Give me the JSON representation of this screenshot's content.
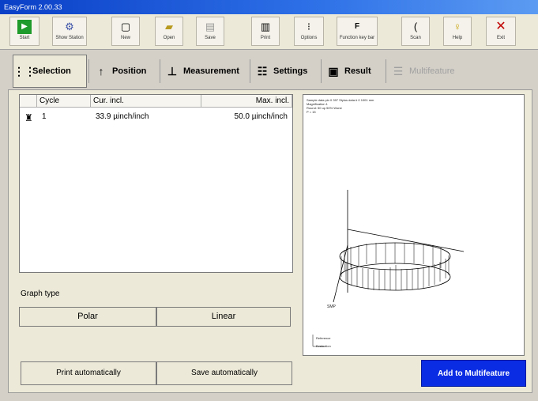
{
  "window": {
    "title": "EasyForm 2.00.33"
  },
  "toolbar": {
    "buttons": [
      {
        "label": "Start",
        "icon": "play-icon"
      },
      {
        "label": "Show Station",
        "icon": "station-icon"
      },
      {
        "label": "New",
        "icon": "new-file-icon"
      },
      {
        "label": "Open",
        "icon": "open-folder-icon"
      },
      {
        "label": "Save",
        "icon": "save-icon"
      },
      {
        "label": "Print",
        "icon": "print-icon"
      },
      {
        "label": "Options",
        "icon": "options-icon"
      },
      {
        "label": "Function key bar",
        "icon": "function-key-icon"
      },
      {
        "label": "Scan",
        "icon": "scan-icon"
      },
      {
        "label": "Help",
        "icon": "help-icon"
      },
      {
        "label": "Exit",
        "icon": "close-icon"
      }
    ]
  },
  "tabs": [
    {
      "label": "Selection",
      "icon": "selection-grid-icon"
    },
    {
      "label": "Position",
      "icon": "position-arrow-icon"
    },
    {
      "label": "Measurement",
      "icon": "measurement-icon"
    },
    {
      "label": "Settings",
      "icon": "settings-icon"
    },
    {
      "label": "Result",
      "icon": "result-disk-icon"
    },
    {
      "label": "Multifeature",
      "icon": "multifeature-icon"
    }
  ],
  "results_table": {
    "columns": [
      "Cycle",
      "Cur. incl.",
      "Max. incl."
    ],
    "rows": [
      {
        "cycle": "1",
        "cur": "33.9 µinch/inch",
        "max": "50.0 µinch/inch"
      }
    ]
  },
  "graph_type": {
    "label": "Graph type",
    "options": [
      "Polar",
      "Linear"
    ]
  },
  "graph": {
    "header_lines": [
      "Sample data pin   0  397  Stylus data #  0 1001 mm",
      "Magnification  1",
      "Round: 50 up  50% Worst",
      "P = 15"
    ],
    "axis_label_bottom": "SMP",
    "legend_lines": [
      "Reference",
      "Evaluation"
    ]
  },
  "actions": {
    "print_auto": "Print automatically",
    "save_auto": "Save automatically",
    "add_multifeature": "Add to Multifeature"
  },
  "colors": {
    "titlebar": "#0a3fc7",
    "add_button": "#0a2ce3",
    "exit_icon": "#c00000",
    "start_icon": "#1f9a2c"
  }
}
